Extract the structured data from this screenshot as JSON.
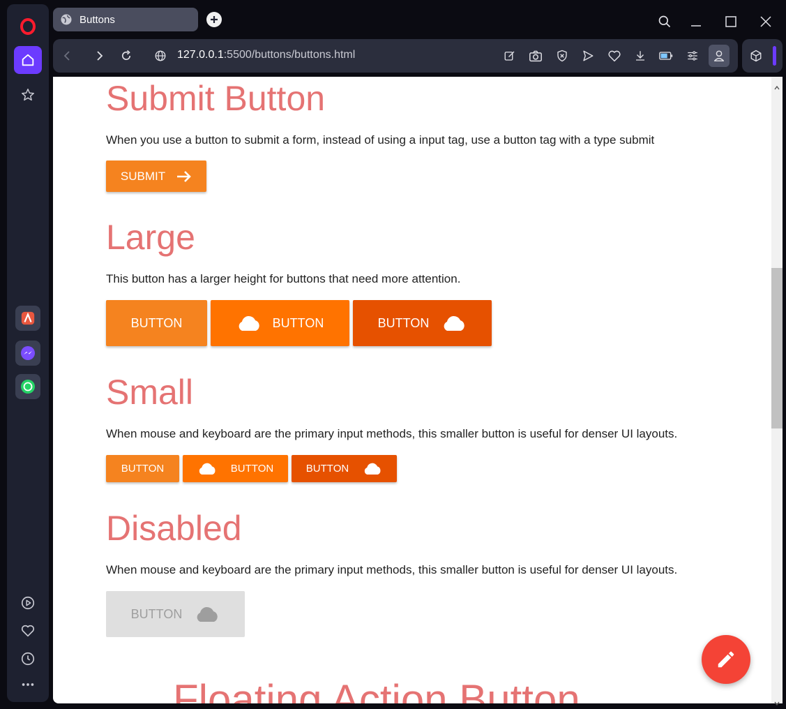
{
  "browser": {
    "tab_title": "Buttons",
    "url_host": "127.0.0.1",
    "url_path": ":5500/buttons/buttons.html"
  },
  "sections": {
    "submit": {
      "title": "Submit Button",
      "description": "When you use a button to submit a form, instead of using a input tag, use a button tag with a type submit",
      "button_label": "SUBMIT"
    },
    "large": {
      "title": "Large",
      "description": "This button has a larger height for buttons that need more attention.",
      "buttons": [
        "BUTTON",
        "BUTTON",
        "BUTTON"
      ]
    },
    "small": {
      "title": "Small",
      "description": "When mouse and keyboard are the primary input methods, this smaller button is useful for denser UI layouts.",
      "buttons": [
        "BUTTON",
        "BUTTON",
        "BUTTON"
      ]
    },
    "disabled": {
      "title": "Disabled",
      "description": "When mouse and keyboard are the primary input methods, this smaller button is useful for denser UI layouts.",
      "button_label": "BUTTON"
    },
    "fab": {
      "title": "Floating Action Button"
    }
  },
  "colors": {
    "accent_orange": "#f5831f",
    "bright_orange": "#ff7300",
    "dark_orange": "#e65100",
    "heading": "#e57373",
    "fab_red": "#f44336",
    "disabled_bg": "#dfdfdf",
    "disabled_text": "#9e9e9e"
  },
  "icons": {
    "sidebar": [
      "opera-logo-icon",
      "home-icon",
      "star-icon",
      "aria-icon",
      "messenger-icon",
      "whatsapp-icon",
      "player-icon",
      "heart-icon",
      "history-icon",
      "more-icon"
    ],
    "toolbar": [
      "back-icon",
      "forward-icon",
      "reload-icon",
      "globe-icon",
      "edit-icon",
      "camera-icon",
      "shield-icon",
      "send-icon",
      "heart-icon",
      "download-icon",
      "battery-icon",
      "settings-icon",
      "profile-icon",
      "cube-icon"
    ],
    "buttons": [
      "arrow-right-icon",
      "cloud-icon"
    ],
    "fab": "pencil-icon"
  }
}
